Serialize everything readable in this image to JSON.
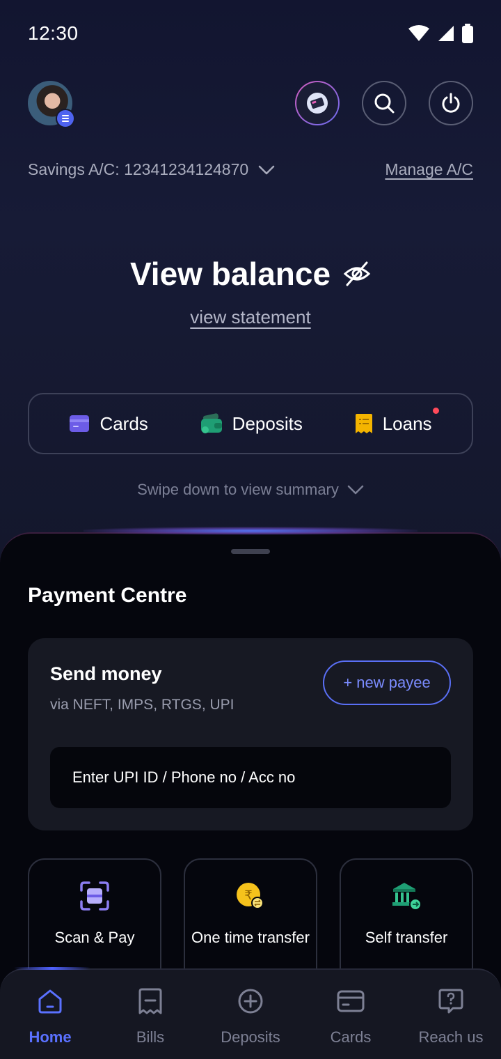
{
  "status": {
    "time": "12:30"
  },
  "account": {
    "label": "Savings A/C: 12341234124870",
    "manage_label": "Manage A/C"
  },
  "balance": {
    "title": "View balance",
    "statement_link": "view statement"
  },
  "quick_actions": [
    {
      "label": "Cards",
      "icon": "card-icon",
      "color": "#6c5ce7"
    },
    {
      "label": "Deposits",
      "icon": "wallet-icon",
      "color": "#1f9e74"
    },
    {
      "label": "Loans",
      "icon": "receipt-icon",
      "color": "#f4b400",
      "has_notification": true
    }
  ],
  "swipe_hint": "Swipe down to view summary",
  "payment_centre": {
    "title": "Payment Centre",
    "send_money": {
      "title": "Send money",
      "subtitle": "via NEFT, IMPS, RTGS, UPI",
      "new_payee_label": "+ new payee",
      "input_placeholder": "Enter UPI ID / Phone no / Acc no"
    },
    "tiles": [
      {
        "label": "Scan & Pay",
        "icon": "scan-icon"
      },
      {
        "label": "One time transfer",
        "icon": "rupee-transfer-icon"
      },
      {
        "label": "Self transfer",
        "icon": "bank-transfer-icon"
      }
    ]
  },
  "bottom_nav": [
    {
      "label": "Home",
      "icon": "home-icon",
      "active": true
    },
    {
      "label": "Bills",
      "icon": "bill-icon"
    },
    {
      "label": "Deposits",
      "icon": "plus-circle-icon"
    },
    {
      "label": "Cards",
      "icon": "card-icon"
    },
    {
      "label": "Reach us",
      "icon": "help-chat-icon"
    }
  ],
  "colors": {
    "accent": "#5a71ff",
    "background_top": "#14172c",
    "sheet": "#05060d",
    "card": "#171923"
  }
}
